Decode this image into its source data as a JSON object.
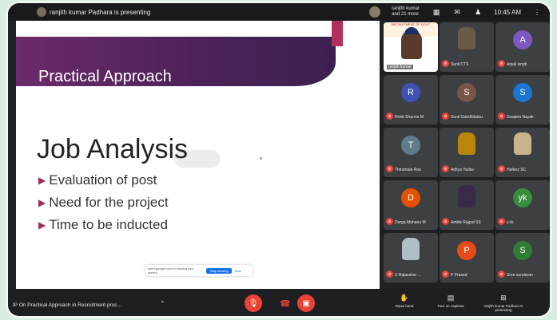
{
  "topbar": {
    "presenting_text": "ranjith kumar Padhara is presenting",
    "others_text": "ranjith kumar and 21 more",
    "time": "10:45 AM"
  },
  "slide": {
    "title": "Practical Approach",
    "heading": "Job Analysis",
    "bullets": [
      "Evaluation of post",
      "Need for the project",
      "Time to be inducted"
    ],
    "stop_message": "meet.google.com is sharing your screen.",
    "stop_button": "Stop sharing",
    "hide_label": "Hide"
  },
  "participants": [
    {
      "name": "ranjith kumar",
      "initial": "",
      "color": "#ffffff",
      "active": true,
      "banner": "RECRUITMENT OF GOVT"
    },
    {
      "name": "Sunil CTS",
      "initial": "",
      "color": "#6b5a4a",
      "photo": true
    },
    {
      "name": "Anjali singh",
      "initial": "A",
      "color": "#7e57c2"
    },
    {
      "name": "Rohit Sharma M",
      "initial": "R",
      "color": "#3f51b5"
    },
    {
      "name": "Sunil Gandhibabu",
      "initial": "S",
      "color": "#795548"
    },
    {
      "name": "Swapna Nayak",
      "initial": "S",
      "color": "#1976d2"
    },
    {
      "name": "Thirumala Rao",
      "initial": "T",
      "color": "#607d8b"
    },
    {
      "name": "Aditya Yadav",
      "initial": "",
      "color": "#b8860b",
      "photo": true
    },
    {
      "name": "Hafeez SC",
      "initial": "",
      "color": "#c9b38a",
      "photo": true
    },
    {
      "name": "Durga Mohana M",
      "initial": "D",
      "color": "#e65100"
    },
    {
      "name": "Ambik Rajput SS",
      "initial": "",
      "color": "#3a2a4a",
      "photo": true
    },
    {
      "name": "y.ck",
      "initial": "yk",
      "color": "#388e3c"
    },
    {
      "name": "S Rajasekar ...",
      "initial": "",
      "color": "#b0bec5",
      "photo": true
    },
    {
      "name": "P Prasad",
      "initial": "P",
      "color": "#e64a19"
    },
    {
      "name": "Sree sundaran",
      "initial": "S",
      "color": "#2e7d32"
    }
  ],
  "bottombar": {
    "meeting_title": "IP On Practical Approach in Recruitment proc...",
    "actions": [
      {
        "icon": "hand-icon",
        "label": "Raise hand"
      },
      {
        "icon": "captions-icon",
        "label": "Turn on captions"
      },
      {
        "icon": "present-icon",
        "label": "ranjith kumar Padhara is presenting"
      }
    ]
  }
}
